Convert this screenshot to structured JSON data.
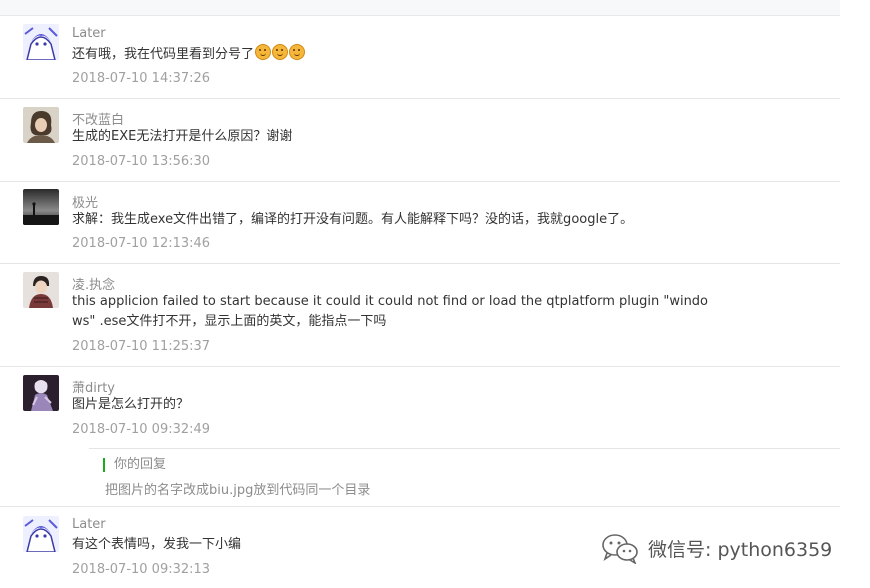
{
  "comments": [
    {
      "nickname": "Later",
      "text": "还有哦，我在代码里看到分号了",
      "emoji_icon": "smirk-emoji-icon",
      "time": "2018-07-10 14:37:26"
    },
    {
      "nickname": "不改蓝白",
      "text": "生成的EXE无法打开是什么原因？谢谢",
      "time": "2018-07-10 13:56:30"
    },
    {
      "nickname": "极光",
      "text": "求解：我生成exe文件出错了，编译的打开没有问题。有人能解释下吗？没的话，我就google了。",
      "time": "2018-07-10 12:13:46"
    },
    {
      "nickname": "凌.执念",
      "text_line1": "this applicion failed to start because it could it could not find or load the qtplatform plugin \"windo",
      "text_line2": "ws\" .ese文件打不开，显示上面的英文，能指点一下吗",
      "time": "2018-07-10 11:25:37"
    },
    {
      "nickname": "萧dirty",
      "text": "图片是怎么打开的？",
      "time": "2018-07-10 09:32:49",
      "reply": {
        "label": "你的回复",
        "text": "把图片的名字改成biu.jpg放到代码同一个目录"
      }
    },
    {
      "nickname": "Later",
      "text": "有这个表情吗，发我一下小编",
      "time": "2018-07-10 09:32:13"
    }
  ],
  "watermark": {
    "icon": "wechat-logo-icon",
    "text": "微信号: python6359"
  }
}
